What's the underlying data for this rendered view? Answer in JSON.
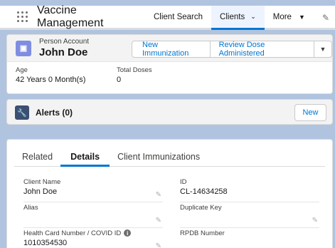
{
  "nav": {
    "app_name": "Vaccine Management",
    "items": [
      {
        "label": "Client Search"
      },
      {
        "label": "Clients"
      },
      {
        "label": "More"
      }
    ],
    "chevron": "⌄",
    "more_chevron": "▼"
  },
  "header": {
    "type": "Person Account",
    "name": "John Doe",
    "buttons": {
      "new_immunization": "New Immunization",
      "review_dose": "Review Dose Administered",
      "dropdown": "▼"
    },
    "fields": [
      {
        "label": "Age",
        "value": "42 Years 0 Month(s)"
      },
      {
        "label": "Total Doses",
        "value": "0"
      }
    ]
  },
  "alerts": {
    "title": "Alerts (0)",
    "new_label": "New"
  },
  "detail": {
    "tabs": [
      "Related",
      "Details",
      "Client Immunizations"
    ],
    "active_tab": "Details",
    "fields": {
      "client_name": {
        "label": "Client Name",
        "value": "John Doe"
      },
      "id": {
        "label": "ID",
        "value": "CL-14634258"
      },
      "alias": {
        "label": "Alias",
        "value": ""
      },
      "duplicate_key": {
        "label": "Duplicate Key",
        "value": ""
      },
      "health_card": {
        "label": "Health Card Number / COVID ID",
        "value": "1010354530"
      },
      "rpdb": {
        "label": "RPDB Number",
        "value": ""
      }
    }
  },
  "colors": {
    "brand": "#0176d3",
    "background": "#b0c4df",
    "account_icon": "#7f8de1",
    "alert_icon": "#3c4f73"
  }
}
